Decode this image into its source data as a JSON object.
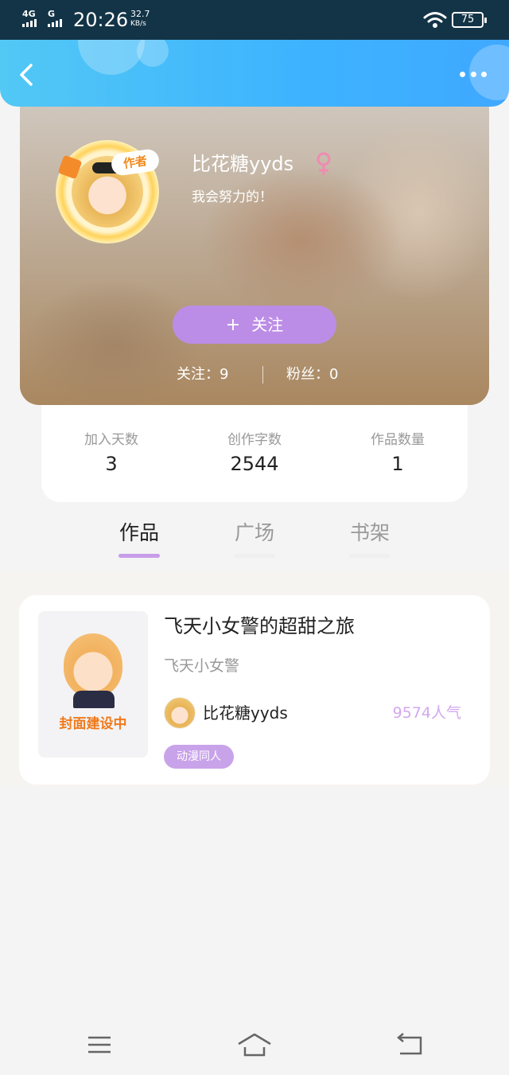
{
  "status_bar": {
    "network_1": "4G",
    "network_2": "G",
    "time": "20:26",
    "speed_value": "32.7",
    "speed_unit": "KB/s",
    "battery": "75"
  },
  "header": {
    "back_icon": "chevron-left-icon",
    "more_icon": "more-horizontal-icon",
    "background_color": "#3db3ff"
  },
  "profile": {
    "username": "比花糖yyds",
    "gender_icon": "female-icon",
    "bio": "我会努力的！",
    "author_badge": "作者",
    "follow_button_plus": "+",
    "follow_button_label": "关注",
    "following_text": "关注：9",
    "fans_text": "粉丝：0",
    "accent_color": "#bc8de6"
  },
  "stats": [
    {
      "label": "加入天数",
      "value": "3"
    },
    {
      "label": "创作字数",
      "value": "2544"
    },
    {
      "label": "作品数量",
      "value": "1"
    }
  ],
  "tabs": [
    {
      "label": "作品",
      "active": true
    },
    {
      "label": "广场",
      "active": false
    },
    {
      "label": "书架",
      "active": false
    }
  ],
  "works": [
    {
      "cover_text": "封面建设中",
      "title": "飞天小女警的超甜之旅",
      "subtitle": "飞天小女警",
      "author": "比花糖yyds",
      "popularity": "9574人气",
      "tag": "动漫同人"
    }
  ],
  "nav_bar": {
    "menu_icon": "menu-icon",
    "home_icon": "home-icon",
    "back_icon": "back-icon"
  }
}
